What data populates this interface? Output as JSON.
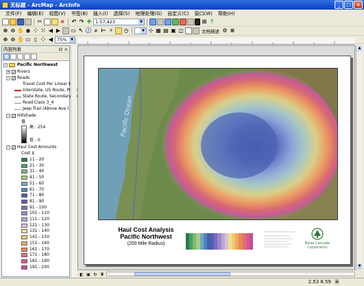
{
  "window": {
    "title": "无标题 - ArcMap - ArcInfo",
    "min": "_",
    "max": "□",
    "close": "×"
  },
  "menu": [
    "文件(F)",
    "编辑(E)",
    "视图(V)",
    "书签(B)",
    "插入(I)",
    "选择(S)",
    "地理处理(G)",
    "自定义(C)",
    "窗口(W)",
    "帮助(H)"
  ],
  "toolbar": {
    "scale": "1:57,423",
    "zoom": "75%",
    "text_label": "文档描述"
  },
  "toc": {
    "header": "内容列表",
    "group": "Pacific Northwest",
    "layers": [
      {
        "name": "Rivers",
        "checked": true
      },
      {
        "name": "Roads",
        "checked": true
      }
    ],
    "road_classes": [
      "Travel Cost Per Linear Mile",
      "Interstate, US Route, Primary",
      "State Route, Secondary Ro...",
      "Road Class 3_4",
      "Jeep Trail (Above Ave.)"
    ],
    "hillshade": {
      "name": "Hillshade",
      "value_label": "值",
      "high": "高 : 254",
      "low": "低 : 0"
    },
    "haul": {
      "name": "Haul Cost Amounts",
      "field": "Cost $",
      "classes": [
        {
          "label": "11 - 20",
          "color": "#2a7a48"
        },
        {
          "label": "21 - 30",
          "color": "#4aa06a"
        },
        {
          "label": "31 - 40",
          "color": "#7db96e"
        },
        {
          "label": "41 - 50",
          "color": "#a8cc80"
        },
        {
          "label": "51 - 60",
          "color": "#6fa8c8"
        },
        {
          "label": "61 - 70",
          "color": "#4f86c0"
        },
        {
          "label": "71 - 80",
          "color": "#3a64a8"
        },
        {
          "label": "81 - 90",
          "color": "#5a5ab0"
        },
        {
          "label": "91 - 100",
          "color": "#7a6ac0"
        },
        {
          "label": "101 - 110",
          "color": "#9a88c8"
        },
        {
          "label": "111 - 120",
          "color": "#b8a8d8"
        },
        {
          "label": "121 - 130",
          "color": "#d8c0d8"
        },
        {
          "label": "131 - 140",
          "color": "#f0e090"
        },
        {
          "label": "141 - 150",
          "color": "#f2c870"
        },
        {
          "label": "151 - 160",
          "color": "#f0a860"
        },
        {
          "label": "161 - 170",
          "color": "#e88858"
        },
        {
          "label": "171 - 180",
          "color": "#e07070"
        },
        {
          "label": "181 - 190",
          "color": "#d85a8a"
        },
        {
          "label": "191 - 200",
          "color": "#c84aa0"
        }
      ]
    }
  },
  "map": {
    "ocean_label": "Pacific Ocean",
    "title_line1": "Haul Cost Analysis",
    "title_line2": "Pacific Northwest",
    "subtitle": "(200 Mile Radius)",
    "company_line1": "Boise Cascade",
    "company_line2": "Corporation"
  },
  "status": {
    "coords": "2.53  8.59",
    "unit": "米"
  }
}
